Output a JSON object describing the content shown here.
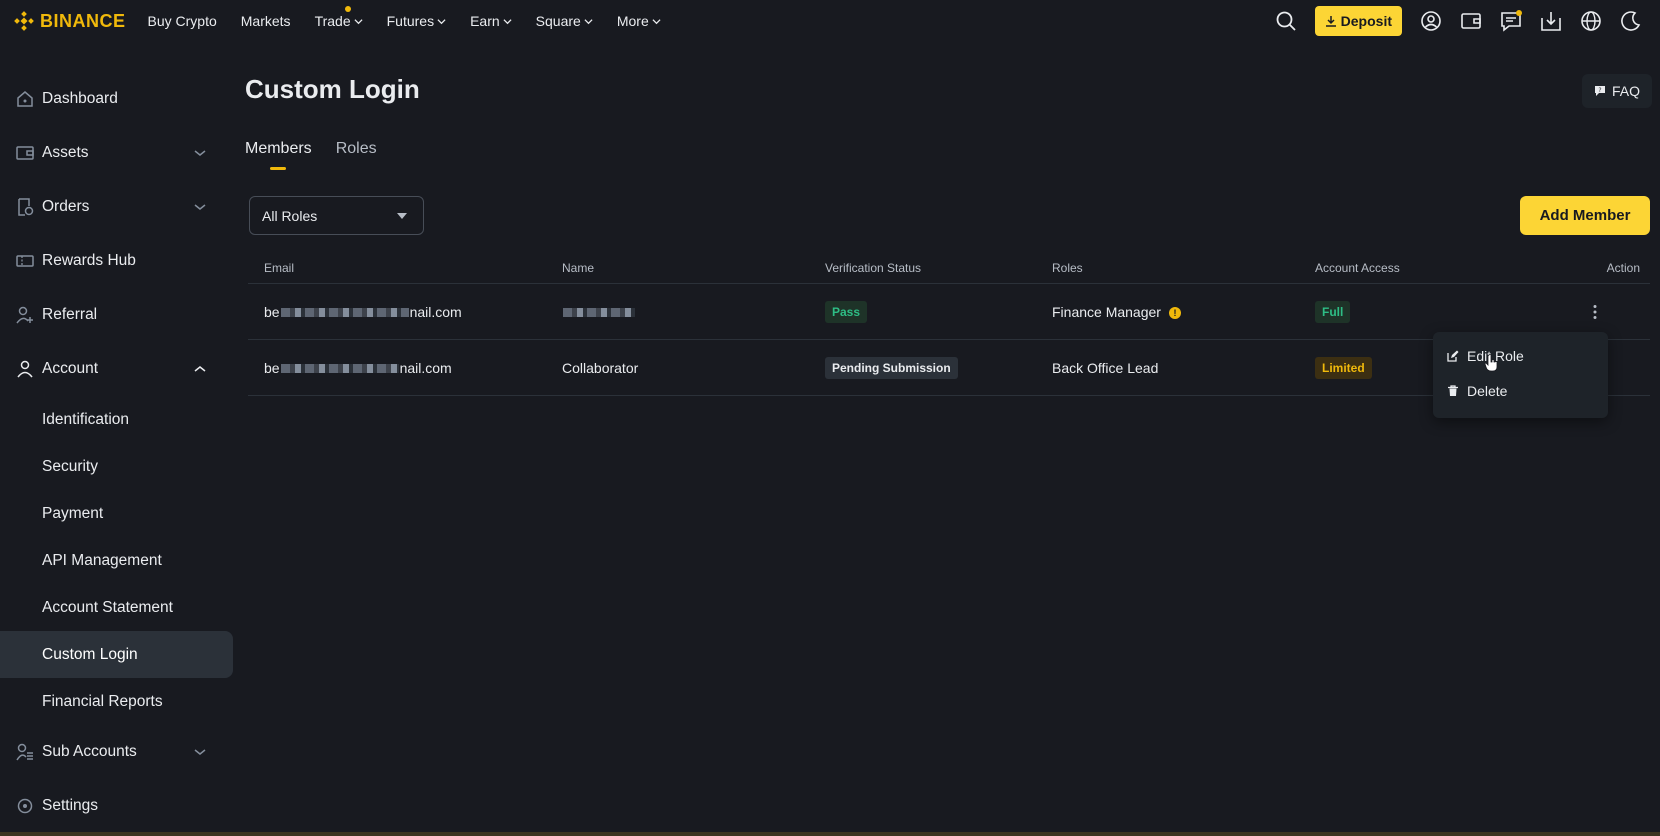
{
  "brand": {
    "name": "BINANCE",
    "color": "#f0b90b"
  },
  "topnav": {
    "items": [
      {
        "label": "Buy Crypto",
        "has_menu": false
      },
      {
        "label": "Markets",
        "has_menu": false
      },
      {
        "label": "Trade",
        "has_menu": true,
        "dot": true
      },
      {
        "label": "Futures",
        "has_menu": true
      },
      {
        "label": "Earn",
        "has_menu": true
      },
      {
        "label": "Square",
        "has_menu": true
      },
      {
        "label": "More",
        "has_menu": true
      }
    ],
    "deposit_label": "Deposit",
    "icons": [
      "search-icon",
      "profile-icon",
      "wallet-icon",
      "messages-icon",
      "download-icon",
      "globe-icon",
      "dark-mode-icon"
    ]
  },
  "sidebar": {
    "dashboard": "Dashboard",
    "assets": "Assets",
    "orders": "Orders",
    "rewards": "Rewards Hub",
    "referral": "Referral",
    "account": "Account",
    "account_sub": [
      "Identification",
      "Security",
      "Payment",
      "API Management",
      "Account Statement",
      "Custom Login",
      "Financial Reports"
    ],
    "active": "Custom Login",
    "sub_accounts": "Sub Accounts",
    "settings": "Settings"
  },
  "page": {
    "title": "Custom Login",
    "faq_label": "FAQ",
    "tabs": [
      "Members",
      "Roles"
    ],
    "active_tab": "Members",
    "role_filter": "All Roles",
    "add_member_label": "Add Member"
  },
  "table": {
    "headers": [
      "Email",
      "Name",
      "Verification Status",
      "Roles",
      "Account Access",
      "Action"
    ],
    "rows": [
      {
        "email_prefix": "be",
        "email_suffix": "nail.com",
        "name": "",
        "status": "Pass",
        "role": "Finance Manager",
        "access": "Full"
      },
      {
        "email_prefix": "be",
        "email_suffix": "nail.com",
        "name": "Collaborator",
        "status": "Pending Submission",
        "role": "Back Office Lead",
        "access": "Limited"
      }
    ]
  },
  "context_menu": {
    "edit": "Edit Role",
    "delete": "Delete"
  },
  "colors": {
    "accent": "#fcd535",
    "bg": "#181a20",
    "panel": "#1e2329",
    "pass": "#2ebd85"
  }
}
